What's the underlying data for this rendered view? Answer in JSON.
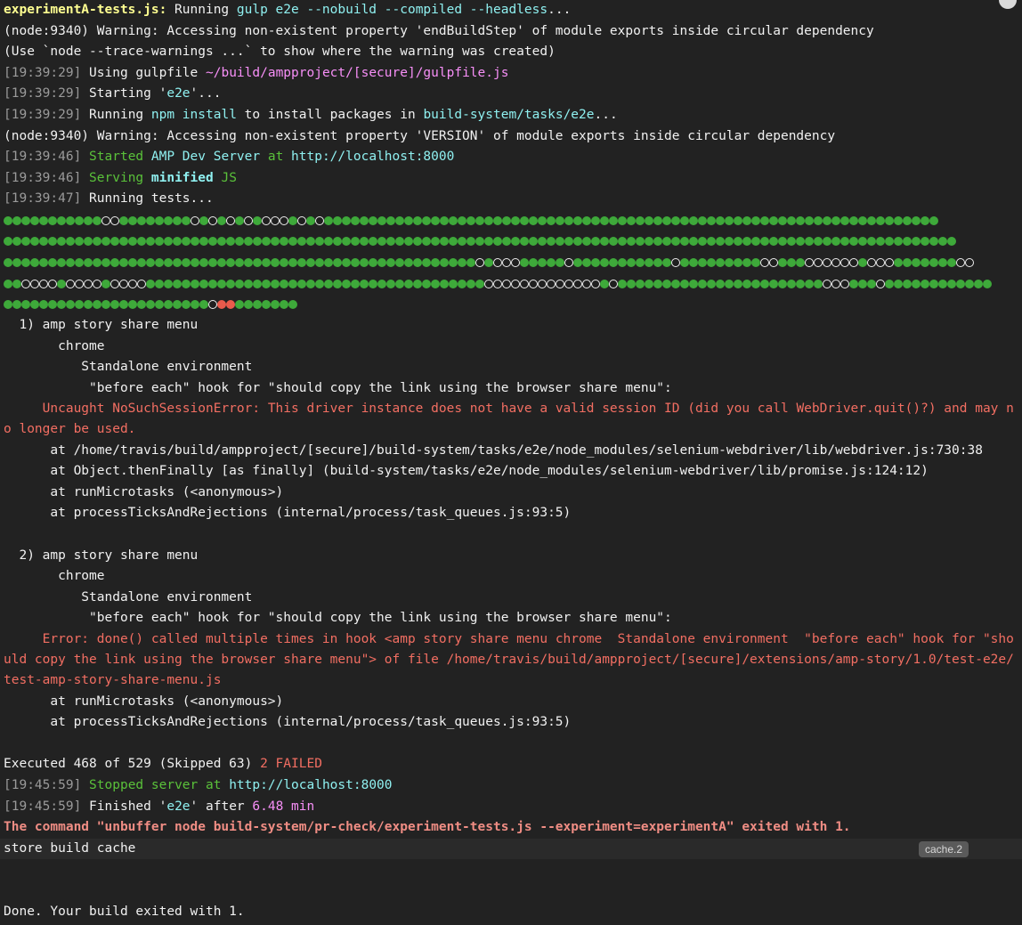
{
  "header": {
    "job": "experimentA-tests.js:",
    "running": " Running ",
    "cmd": "gulp e2e --nobuild --compiled --headless",
    "ellipsis": "..."
  },
  "warn1": "(node:9340) Warning: Accessing non-existent property 'endBuildStep' of module exports inside circular dependency",
  "warn2": "(Use `node --trace-warnings ...` to show where the warning was created)",
  "l_gulpfile": {
    "open": "[",
    "ts": "19:39:29",
    "close": "]",
    "text": " Using gulpfile ",
    "path": "~/build/ampproject/[secure]/gulpfile.js"
  },
  "l_starting": {
    "open": "[",
    "ts": "19:39:29",
    "close": "]",
    "pre": " Starting '",
    "task": "e2e",
    "post": "'..."
  },
  "l_npm": {
    "open": "[",
    "ts": "19:39:29",
    "close": "]",
    "pre": " Running ",
    "cmd": "npm install",
    "mid": " to install packages in ",
    "dir": "build-system/tasks/e2e",
    "post": "..."
  },
  "warn3": "(node:9340) Warning: Accessing non-existent property 'VERSION' of module exports inside circular dependency",
  "l_started": {
    "open": "[",
    "ts": "19:39:46",
    "close": "]",
    "sp": " ",
    "started": "Started",
    "sp2": " ",
    "server": "AMP Dev Server",
    "at": " at ",
    "url": "http://localhost:8000"
  },
  "l_serving": {
    "open": "[",
    "ts": "19:39:46",
    "close": "]",
    "sp": " ",
    "serving": "Serving",
    "sp2": " ",
    "minified": "minified",
    "js": " JS"
  },
  "l_running": {
    "open": "[",
    "ts": "19:39:47",
    "close": "]",
    "text": " Running tests..."
  },
  "progress_rows": [
    "gggggggggggppggggggggpgpgpgpgpppgpgpggggggggggggggggggggggggggggggggggggggggggggggggggggggggggggggggggggg",
    "ggggggggggggggggggggggggggggggggggggggggggggggggggggggggggggggggggggggggggggggggggggggggggggggggggggggggggg",
    "gggggggggggggggggggggggggggggggggggggggggggggggggggggpgpppgggggpgggggggggggpgggggggggppgggppppppgpppgggggggpp",
    "ggppppgppppgppppggggggggggggggggggggggggggggggggggggggpppppppppppppgpgggggggggggggggggggggggpppgggpgggggggggggg",
    "gggggggggggggggggggggggpffggggggg"
  ],
  "failures": [
    {
      "title": "  1) amp story share menu",
      "browser": "       chrome",
      "env": "          Standalone environment",
      "hook": "           \"before each\" hook for \"should copy the link using the browser share menu\":",
      "error": "     Uncaught NoSuchSessionError: This driver instance does not have a valid session ID (did you call WebDriver.quit()?) and may no longer be used.",
      "stack": [
        "      at /home/travis/build/ampproject/[secure]/build-system/tasks/e2e/node_modules/selenium-webdriver/lib/webdriver.js:730:38",
        "      at Object.thenFinally [as finally] (build-system/tasks/e2e/node_modules/selenium-webdriver/lib/promise.js:124:12)",
        "      at runMicrotasks (<anonymous>)",
        "      at processTicksAndRejections (internal/process/task_queues.js:93:5)"
      ]
    },
    {
      "title": "  2) amp story share menu",
      "browser": "       chrome",
      "env": "          Standalone environment",
      "hook": "           \"before each\" hook for \"should copy the link using the browser share menu\":",
      "error": "     Error: done() called multiple times in hook <amp story share menu chrome  Standalone environment  \"before each\" hook for \"should copy the link using the browser share menu\"> of file /home/travis/build/ampproject/[secure]/extensions/amp-story/1.0/test-e2e/test-amp-story-share-menu.js",
      "stack": [
        "      at runMicrotasks (<anonymous>)",
        "      at processTicksAndRejections (internal/process/task_queues.js:93:5)"
      ]
    }
  ],
  "summary": {
    "text": "Executed 468 of 529 (Skipped 63) ",
    "failed": "2 FAILED"
  },
  "l_stopped": {
    "open": "[",
    "ts": "19:45:59",
    "close": "]",
    "sp": " ",
    "stopped": "Stopped server",
    "at": " at ",
    "url": "http://localhost:8000"
  },
  "l_finished": {
    "open": "[",
    "ts": "19:45:59",
    "close": "]",
    "pre": " Finished '",
    "task": "e2e",
    "mid": "' after ",
    "dur": "6.48 min"
  },
  "cmd_exit": "The command \"unbuffer node build-system/pr-check/experiment-tests.js --experiment=experimentA\" exited with 1.",
  "fold": {
    "label": "store build cache",
    "badge": "cache.2"
  },
  "done": "Done. Your build exited with 1.",
  "icons": {
    "corner": "expand-circle-icon"
  },
  "colors": {
    "background": "#222222",
    "green": "#5ac13a",
    "cyan": "#8ff0f0",
    "magenta": "#f78ff7",
    "yellow": "#ffff91",
    "red": "#f26e62"
  }
}
